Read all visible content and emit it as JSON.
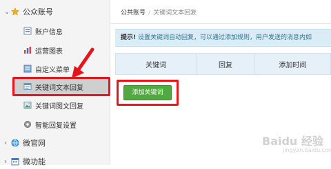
{
  "sidebar": {
    "group1": {
      "label": "公众账号",
      "icon": "gold-star-icon"
    },
    "items": [
      {
        "label": "账户信息",
        "icon": "account-info-icon"
      },
      {
        "label": "运营图表",
        "icon": "bar-chart-icon"
      },
      {
        "label": "自定义菜单",
        "icon": "custom-menu-icon"
      },
      {
        "label": "关键词文本回复",
        "icon": "text-reply-icon"
      },
      {
        "label": "关键词图文回复",
        "icon": "image-text-reply-icon"
      },
      {
        "label": "智能回复设置",
        "icon": "gear-icon"
      }
    ],
    "group2": {
      "label": "微官网",
      "icon": "globe-icon"
    },
    "group3": {
      "label": "微功能",
      "icon": "calendar-icon"
    }
  },
  "breadcrumb": {
    "root": "公共账号",
    "separator": "/",
    "current": "关键词文本回复"
  },
  "tip": {
    "prefix": "提示!",
    "text": "设置关键词自动回复，可以通过添加规则，用户发送的消息内如"
  },
  "table": {
    "columns": [
      "关键词",
      "回复",
      "添加时间"
    ]
  },
  "add_button": {
    "label": "添加关键词"
  },
  "watermark": {
    "brand": "Baidu 经验",
    "url": "jingyan.baidu.com"
  },
  "colors": {
    "highlight": "#e8141b",
    "button": "#53a941",
    "tip_bg": "#d9edf7",
    "header_bg": "#e6f0f8"
  }
}
